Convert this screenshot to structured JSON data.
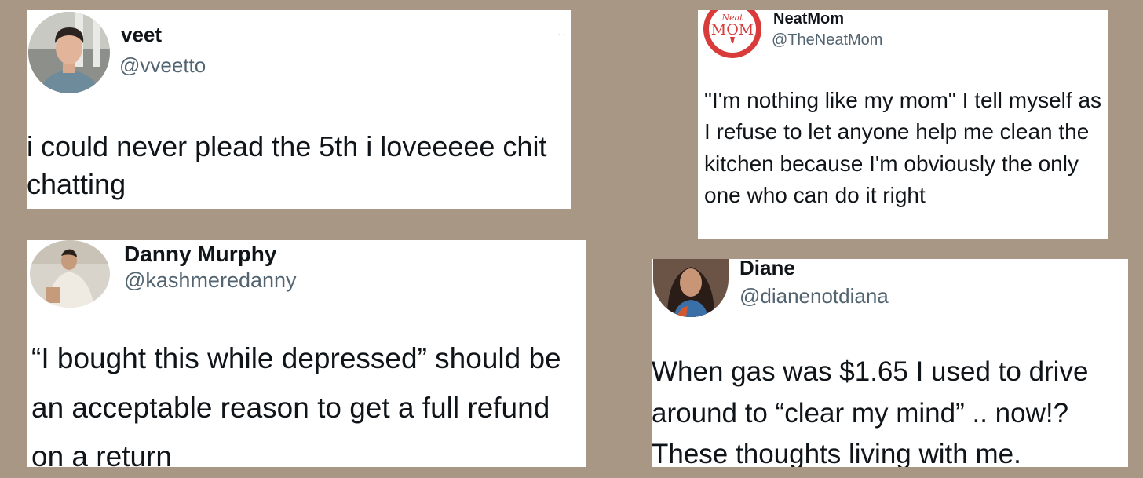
{
  "tweets": [
    {
      "name": "veet",
      "handle": "@vveetto",
      "text": "i could never plead the 5th i loveeeee chit chatting",
      "more": "··"
    },
    {
      "name": "NeatMom",
      "handle": "@TheNeatMom",
      "text": "\"I'm nothing like my mom\" I tell myself as I refuse to let anyone help me clean the kitchen because I'm obviously the only one who can do it right",
      "avatar_logo": "Neat MOM"
    },
    {
      "name": "Danny Murphy",
      "handle": "@kashmeredanny",
      "text": "“I bought this while depressed” should be an acceptable reason to get a full refund on a return"
    },
    {
      "name": "Diane",
      "handle": "@dianenotdiana",
      "text": "When gas was $1.65 I used to drive around to “clear my mind” .. now!? These thoughts living with me."
    }
  ],
  "colors": {
    "background": "#a99785",
    "card": "#ffffff",
    "text": "#0f1419",
    "handle": "#536471",
    "neatmom_red": "#d93a3a"
  }
}
